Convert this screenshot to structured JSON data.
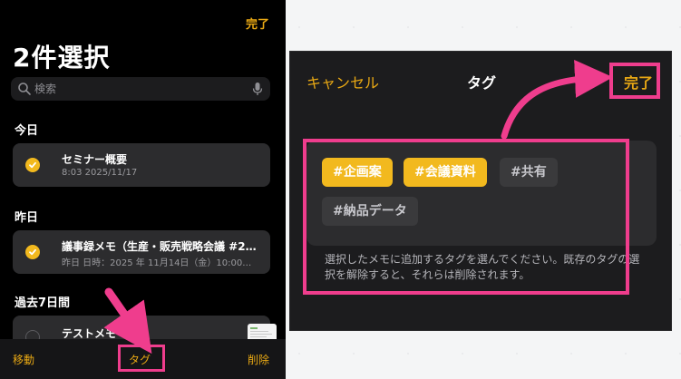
{
  "left_phone": {
    "done_label": "完了",
    "title": "2件選択",
    "search_placeholder": "検索",
    "sections": [
      {
        "label": "今日"
      },
      {
        "label": "昨日"
      },
      {
        "label": "過去7日間"
      }
    ],
    "notes": [
      {
        "title": "セミナー概要",
        "subtitle": "8:03  2025/11/17",
        "selected": true
      },
      {
        "title": "議事録メモ（生産・販売戦略会議 #2…",
        "subtitle": "昨日  日時：2025 年 11月14日（金）10:00…",
        "selected": true
      },
      {
        "title": "テストメモ",
        "subtitle": "",
        "selected": false
      }
    ],
    "toolbar": {
      "move_label": "移動",
      "tag_label": "タグ",
      "delete_label": "削除"
    }
  },
  "tag_sheet": {
    "cancel_label": "キャンセル",
    "title": "タグ",
    "done_label": "完了",
    "tags": [
      {
        "label": "#企画案",
        "selected": true
      },
      {
        "label": "#会議資料",
        "selected": true
      },
      {
        "label": "#共有",
        "selected": false
      },
      {
        "label": "#納品データ",
        "selected": false
      }
    ],
    "description": "選択したメモに追加するタグを選んでください。既存のタグの選択を解除すると、それらは削除されます。"
  },
  "colors": {
    "accent": "#e8a814",
    "check": "#f2b91e",
    "highlight": "#ef3d8d"
  }
}
